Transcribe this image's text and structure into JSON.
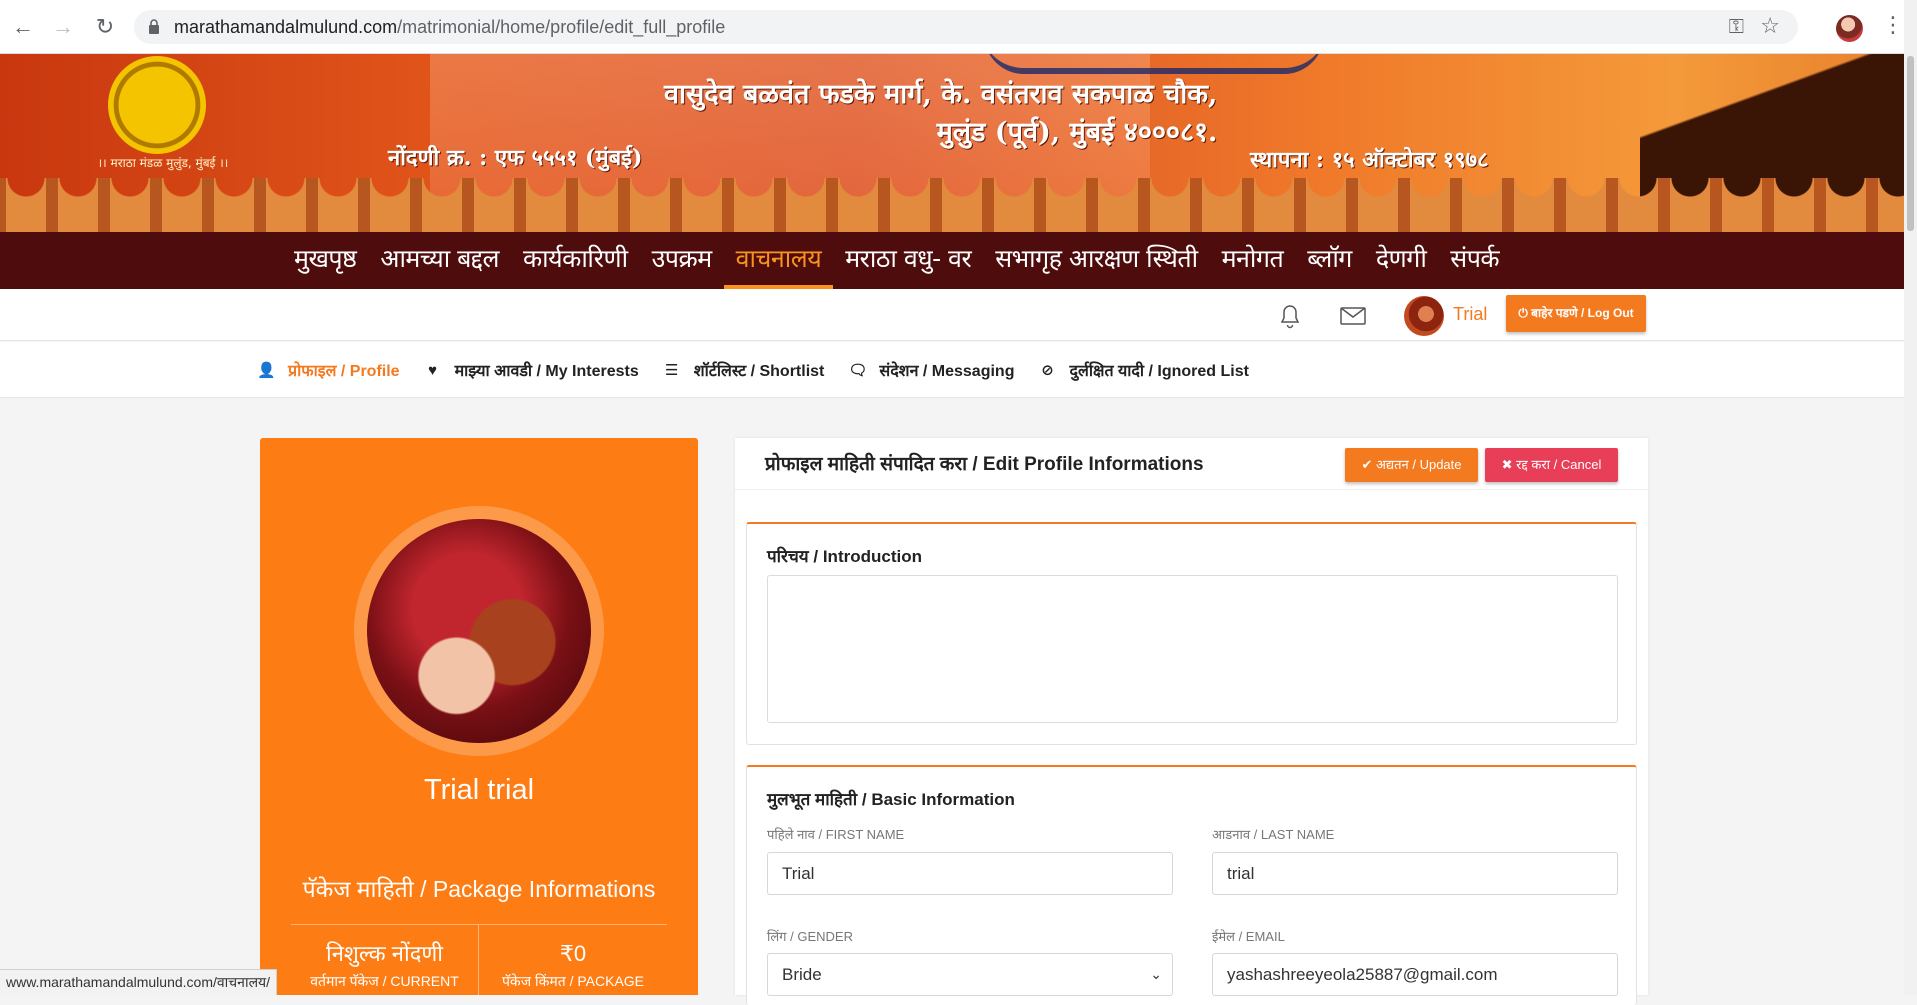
{
  "browser": {
    "url_domain": "marathamandalmulund.com",
    "url_path": "/matrimonial/home/profile/edit_full_profile",
    "status_url": "www.marathamandalmulund.com/वाचनालय/"
  },
  "banner": {
    "address_line1": "वासुदेव बळवंत फडके मार्ग, के. वसंतराव सकपाळ चौक,",
    "address_line2": "मुलुंड (पूर्व), मुंबई ४०००८१.",
    "registration": "नोंदणी क्र. : एफ ५५५१ (मुंबई)",
    "established": "स्थापना : १५ ऑक्टोबर १९७८",
    "logo_caption": "।। मराठा मंडळ मुलुंड, मुंबई ।।"
  },
  "main_nav": [
    {
      "label": "मुखपृष्ठ",
      "active": false
    },
    {
      "label": "आमच्या बद्दल",
      "active": false
    },
    {
      "label": "कार्यकारिणी",
      "active": false
    },
    {
      "label": "उपक्रम",
      "active": false
    },
    {
      "label": "वाचनालय",
      "active": true
    },
    {
      "label": "मराठा वधु- वर",
      "active": false
    },
    {
      "label": "सभागृह आरक्षण स्थिती",
      "active": false
    },
    {
      "label": "मनोगत",
      "active": false
    },
    {
      "label": "ब्लॉग",
      "active": false
    },
    {
      "label": "देणगी",
      "active": false
    },
    {
      "label": "संपर्क",
      "active": false
    }
  ],
  "user": {
    "name": "Trial",
    "logout_label": "⏻ बाहेर पडणे / Log Out"
  },
  "sub_nav": [
    {
      "icon": "user-icon",
      "glyph": "👤",
      "label": "प्रोफाइल / Profile",
      "active": true
    },
    {
      "icon": "heart-icon",
      "glyph": "♥",
      "label": "माझ्या आवडी / My Interests",
      "active": false
    },
    {
      "icon": "list-icon",
      "glyph": "☰",
      "label": "शॉर्टलिस्ट / Shortlist",
      "active": false
    },
    {
      "icon": "comments-icon",
      "glyph": "🗨",
      "label": "संदेशन / Messaging",
      "active": false
    },
    {
      "icon": "ban-icon",
      "glyph": "⊘",
      "label": "दुर्लक्षित यादी / Ignored List",
      "active": false
    }
  ],
  "profile_card": {
    "name": "Trial trial",
    "package_title": "पॅकेज माहिती / Package Informations",
    "package_name": "निशुल्क नोंदणी",
    "package_current_label": "वर्तमान पॅकेज / CURRENT",
    "package_price": "₹0",
    "package_price_label": "पॅकेज किंमत / PACKAGE"
  },
  "edit_panel": {
    "title": "प्रोफाइल माहिती संपादित करा / Edit Profile Informations",
    "update_label": "✔ अद्यतन / Update",
    "cancel_label": "✖ रद्द करा / Cancel",
    "intro_title": "परिचय / Introduction",
    "intro_value": "",
    "basic_title": "मुलभूत माहिती / Basic Information",
    "fields": {
      "first_name_label": "पहिले नाव / FIRST NAME",
      "first_name_value": "Trial",
      "last_name_label": "आडनाव / LAST NAME",
      "last_name_value": "trial",
      "gender_label": "लिंग / GENDER",
      "gender_value": "Bride",
      "email_label": "ईमेल / EMAIL",
      "email_value": "yashashreeyeola25887@gmail.com"
    }
  },
  "colors": {
    "accent": "#f47a20",
    "nav_bg": "#4e0c0c",
    "cancel": "#e83e57"
  }
}
